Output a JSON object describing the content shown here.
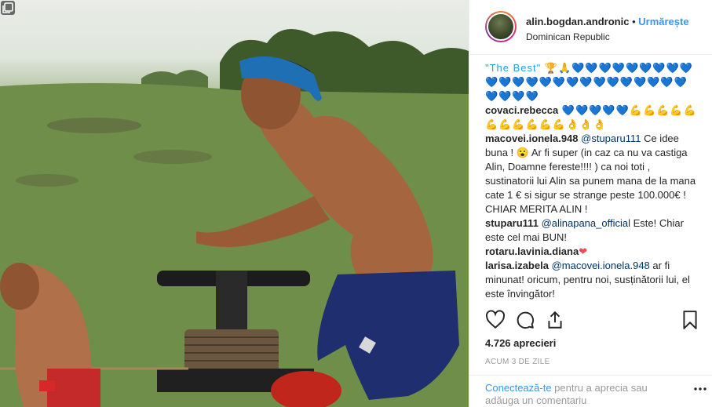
{
  "post": {
    "username": "alin.bogdan.andronic",
    "separator": "•",
    "follow_label": "Urmărește",
    "location": "Dominican Republic"
  },
  "comments": [
    {
      "user": "",
      "text": "\"The Best\" 🏆🙏💙💙💙💙💙💙💙💙💙💙💙💙💙💙💙💙💙💙💙💙💙💙💙💙💙💙💙💙"
    },
    {
      "user": "covaci.rebecca",
      "text": " 💙💙💙💙💙💪💪💪💪💪💪💪💪💪💪💪👌👌👌"
    },
    {
      "user": "macovei.ionela.948",
      "mention": "@stuparu111",
      "text": " Ce idee buna ! 😮 Ar fi super (in caz ca nu va castiga Alin, Doamne fereste!!!! ) ca noi toti , sustinatorii lui Alin sa punem mana de la mana cate 1 € si sigur se strange peste 100.000€ ! CHIAR MERITA ALIN !"
    },
    {
      "user": "stuparu111",
      "mention": "@alinapana_official",
      "text": " Este! Chiar este cel mai BUN!"
    },
    {
      "user": "rotaru.lavinia.diana",
      "text": "❤"
    },
    {
      "user": "larisa.izabela",
      "mention": "@macovei.ionela.948",
      "text": " ar fi minunat! oricum, pentru noi, susținătorii lui, el este învingător!"
    }
  ],
  "likes_text": "4.726 aprecieri",
  "time_text": "ACUM 3 DE ZILE",
  "footer": {
    "login_link": "Conectează-te",
    "login_rest": " pentru a aprecia sau adăuga un comentariu"
  },
  "icons": {
    "like": "heart-icon",
    "comment": "comment-icon",
    "share": "share-icon",
    "save": "bookmark-icon",
    "more": "more-icon",
    "multi": "carousel-icon"
  }
}
